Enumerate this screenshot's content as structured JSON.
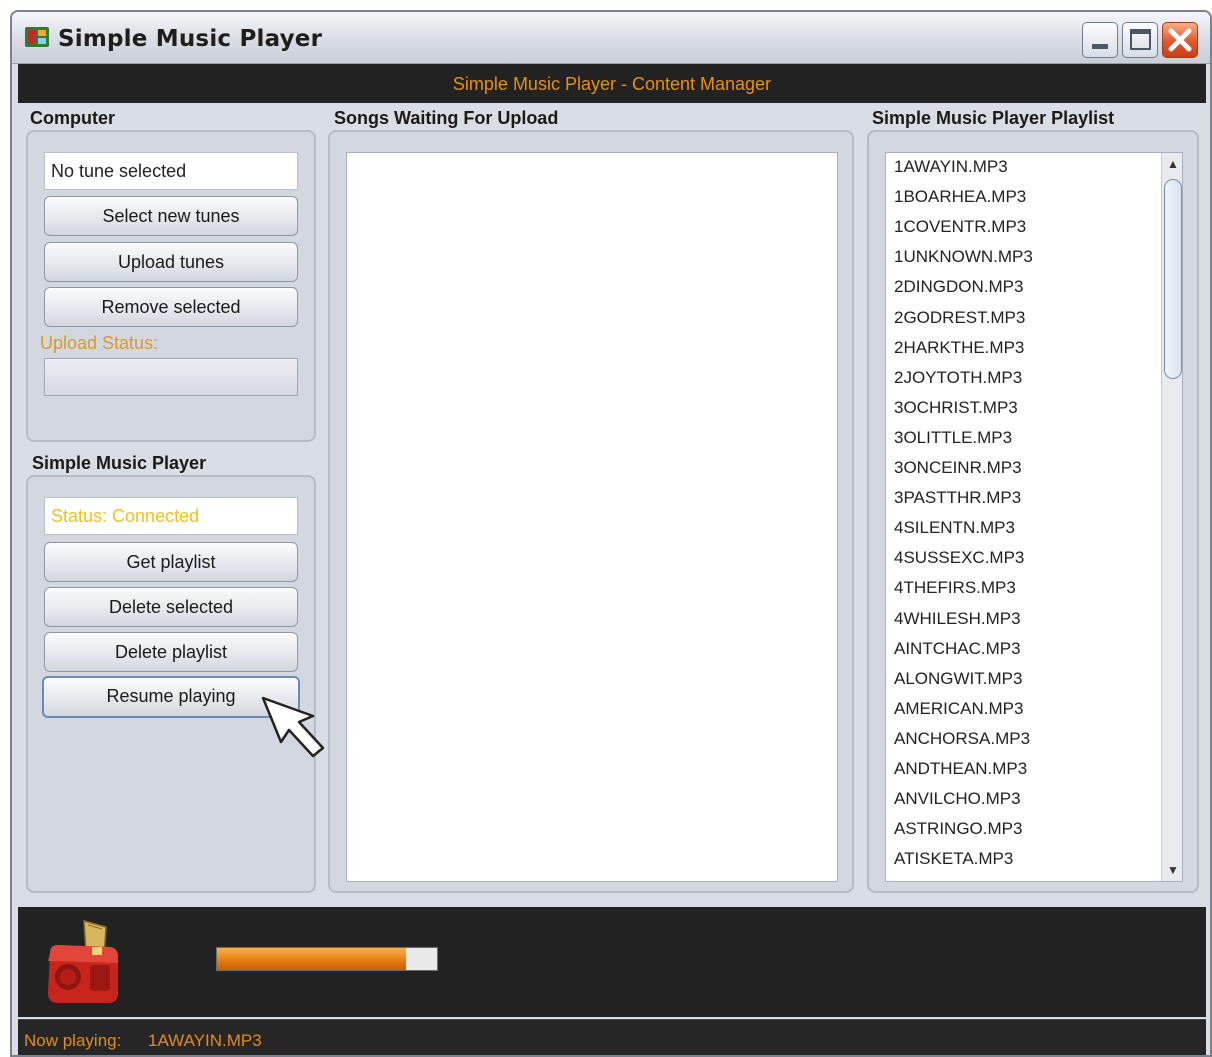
{
  "window": {
    "title": "Simple Music Player",
    "icon": "music-app-icon",
    "controls": [
      "minimize-icon",
      "maximize-icon",
      "close-icon"
    ]
  },
  "header": {
    "title": "Simple Music Player - Content Manager"
  },
  "computer": {
    "title": "Computer",
    "selected_tune": "No tune selected",
    "select_new_label": "Select new tunes",
    "upload_label": "Upload tunes",
    "remove_label": "Remove selected",
    "upload_status_label": "Upload Status:",
    "upload_progress": 0
  },
  "player": {
    "title": "Simple Music Player",
    "status": "Status: Connected",
    "get_playlist_label": "Get playlist",
    "delete_selected_label": "Delete selected",
    "delete_playlist_label": "Delete playlist",
    "resume_label": "Resume playing"
  },
  "upload_queue": {
    "title": "Songs Waiting For Upload",
    "items": []
  },
  "playlist": {
    "title": "Simple Music Player Playlist",
    "items": [
      "1AWAYIN.MP3",
      "1BOARHEA.MP3",
      "1COVENTR.MP3",
      "1UNKNOWN.MP3",
      "2DINGDON.MP3",
      "2GODREST.MP3",
      "2HARKTHE.MP3",
      "2JOYTOTH.MP3",
      "3OCHRIST.MP3",
      "3OLITTLE.MP3",
      "3ONCEINR.MP3",
      "3PASTTHR.MP3",
      "4SILENTN.MP3",
      "4SUSSEXC.MP3",
      "4THEFIRS.MP3",
      "4WHILESH.MP3",
      "AINTCHAC.MP3",
      "ALONGWIT.MP3",
      "AMERICAN.MP3",
      "ANCHORSA.MP3",
      "ANDTHEAN.MP3",
      "ANVILCHO.MP3",
      "ASTRINGO.MP3",
      "ATISKETA.MP3"
    ]
  },
  "bottom": {
    "icon": "radio-icon",
    "volume": 0.86
  },
  "status_bar": {
    "now_playing_label": "Now playing:",
    "now_playing_value": "1AWAYIN.MP3"
  },
  "colors": {
    "accent": "#e8900f",
    "status_text": "#d79a33",
    "dark_bar": "#222222",
    "close_red": "#e2562a"
  }
}
